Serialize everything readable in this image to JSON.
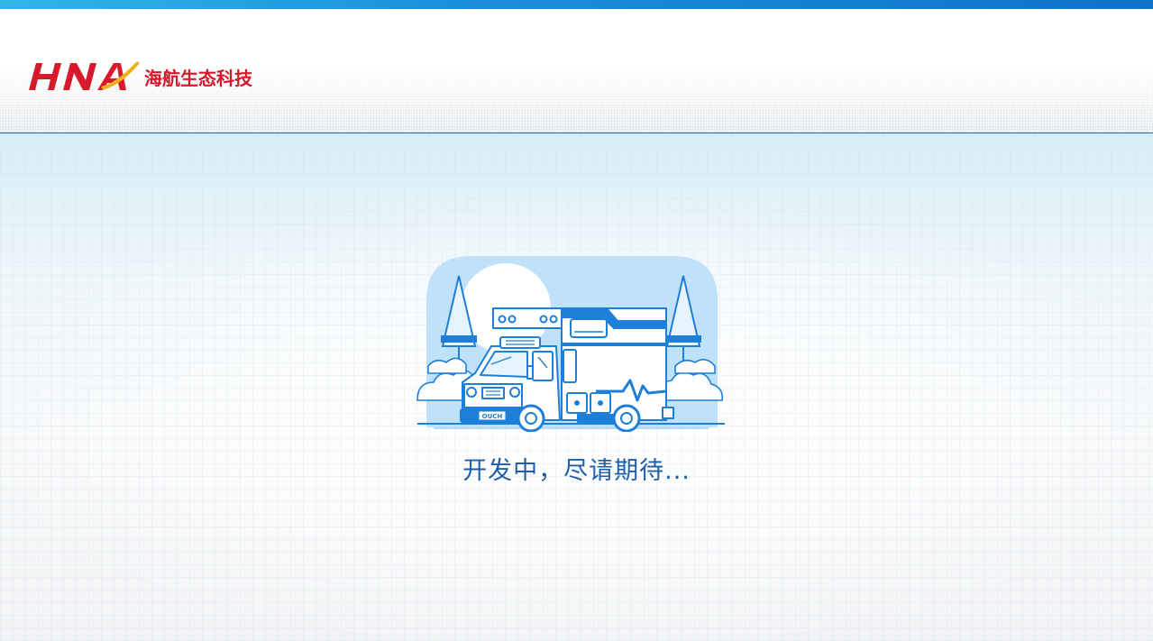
{
  "header": {
    "logo_wordmark": "HNA",
    "company_name": "海航生态科技"
  },
  "main": {
    "status_message": "开发中，尽请期待...",
    "illustration": "ambulance-truck-illustration"
  },
  "colors": {
    "top_strip": "#1a8fdb",
    "brand_red": "#d7192b",
    "brand_yellow": "#f2b01e",
    "message_blue": "#1f5fa8",
    "illustration_blue": "#1e7fd8",
    "illustration_light": "#bfe1fa"
  }
}
